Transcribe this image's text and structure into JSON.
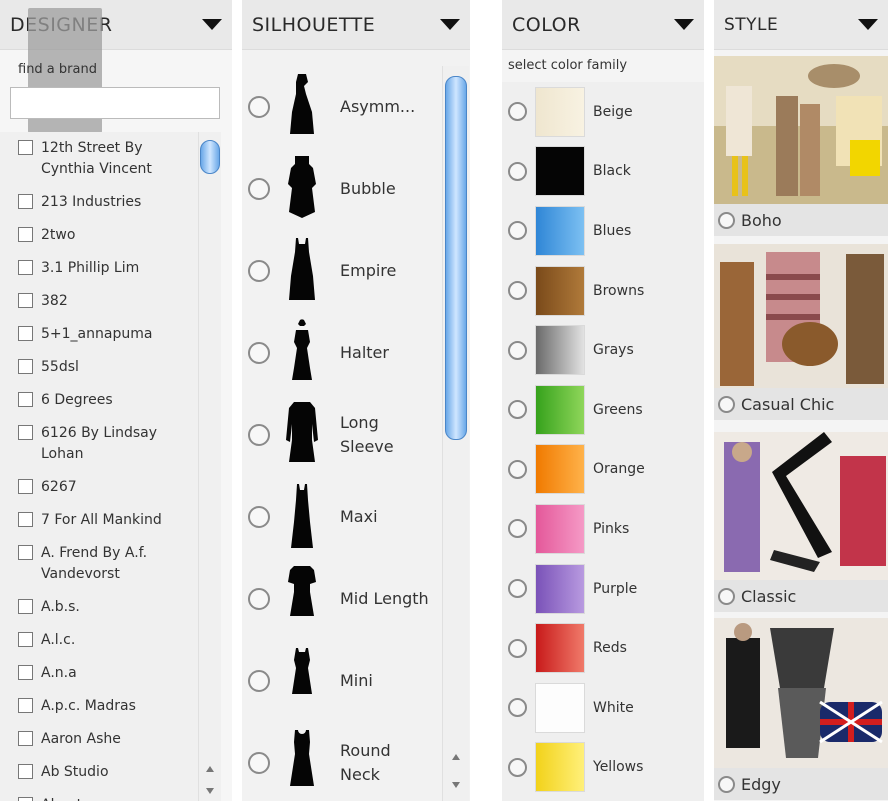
{
  "designer": {
    "title": "DESIGNER",
    "find_label": "find a brand",
    "search_value": "",
    "brands": [
      "12th Street By Cynthia Vincent",
      "213 Industries",
      "2two",
      "3.1 Phillip Lim",
      "382",
      "5+1_annapuma",
      "55dsl",
      "6 Degrees",
      "6126 By Lindsay Lohan",
      "6267",
      "7 For All Mankind",
      "A. Frend By A.f. Vandevorst",
      "A.b.s.",
      "A.l.c.",
      "A.n.a",
      "A.p.c. Madras",
      "Aaron Ashe",
      "Ab Studio",
      "Abaete"
    ]
  },
  "silhouette": {
    "title": "SILHOUETTE",
    "items": [
      {
        "label": "Asymm...",
        "shape": "asymmetric"
      },
      {
        "label": "Bubble",
        "shape": "bubble"
      },
      {
        "label": "Empire",
        "shape": "empire"
      },
      {
        "label": "Halter",
        "shape": "halter"
      },
      {
        "label": "Long Sleeve",
        "shape": "longsleeve"
      },
      {
        "label": "Maxi",
        "shape": "maxi"
      },
      {
        "label": "Mid Length",
        "shape": "midlength"
      },
      {
        "label": "Mini",
        "shape": "mini"
      },
      {
        "label": "Round Neck",
        "shape": "roundneck"
      }
    ]
  },
  "color": {
    "title": "COLOR",
    "subtitle": "select color family",
    "items": [
      {
        "label": "Beige",
        "swatch": "linear-gradient(to right,#efe6cf,#f8f2e2)"
      },
      {
        "label": "Black",
        "swatch": "#050505"
      },
      {
        "label": "Blues",
        "swatch": "linear-gradient(to right,#2f86d6,#7cc0f2)"
      },
      {
        "label": "Browns",
        "swatch": "linear-gradient(to right,#7a4a1a,#b07a3a)"
      },
      {
        "label": "Grays",
        "swatch": "linear-gradient(to right,#6a6a6a,#e2e2e2)"
      },
      {
        "label": "Greens",
        "swatch": "linear-gradient(to right,#36a21c,#8fd65a)"
      },
      {
        "label": "Orange",
        "swatch": "linear-gradient(to right,#f07a00,#ffb24a)"
      },
      {
        "label": "Pinks",
        "swatch": "linear-gradient(to right,#e4589a,#f59ac6)"
      },
      {
        "label": "Purple",
        "swatch": "linear-gradient(to right,#7a52b8,#b89ae0)"
      },
      {
        "label": "Reds",
        "swatch": "linear-gradient(to right,#c81a1a,#f07a6a)"
      },
      {
        "label": "White",
        "swatch": "#fdfdfd"
      },
      {
        "label": "Yellows",
        "swatch": "linear-gradient(to right,#f2d21a,#fff07a)"
      }
    ]
  },
  "style": {
    "title": "STYLE",
    "items": [
      {
        "label": "Boho"
      },
      {
        "label": "Casual Chic"
      },
      {
        "label": "Classic"
      },
      {
        "label": "Edgy"
      }
    ]
  }
}
